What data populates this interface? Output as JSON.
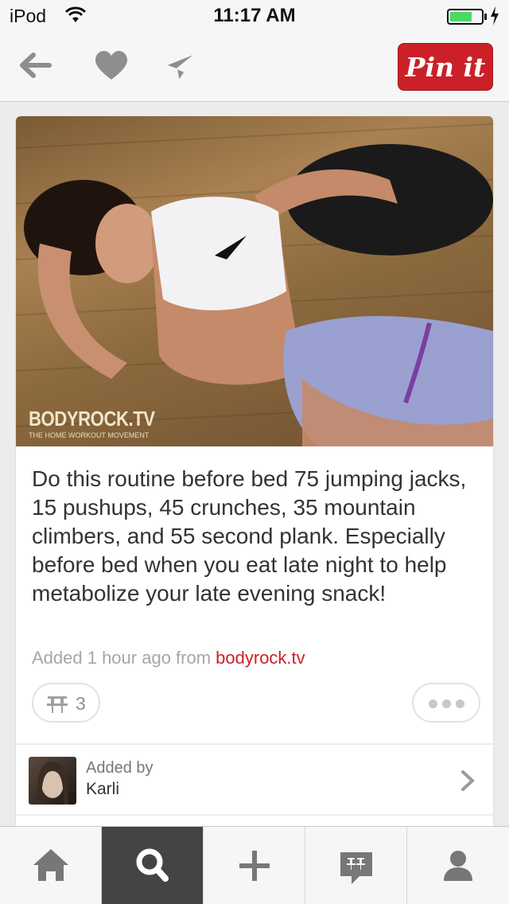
{
  "status_bar": {
    "carrier": "iPod",
    "time": "11:17 AM",
    "battery_level": 0.7,
    "battery_color": "#4cd964"
  },
  "nav_bar": {
    "back_icon": "back-arrow-icon",
    "like_icon": "heart-icon",
    "send_icon": "paper-plane-icon",
    "pin_it_label": "Pin it",
    "brand_color": "#cb2027"
  },
  "pin": {
    "image_watermark": "BODYROCK.TV",
    "image_watermark_sub": "THE HOME WORKOUT MOVEMENT",
    "description": "Do this routine before bed 75 jumping jacks, 15 pushups, 45 crunches, 35 mountain climbers, and 55 second plank. Especially before bed when you eat late night to help metabolize your late evening snack!",
    "added_prefix": "Added 1 hour ago from ",
    "source": "bodyrock.tv",
    "repin_count": "3",
    "added_by_label": "Added by",
    "added_by_name": "Karli"
  },
  "tab_bar": {
    "tabs": [
      {
        "icon": "home-icon",
        "active": false
      },
      {
        "icon": "search-icon",
        "active": true
      },
      {
        "icon": "plus-icon",
        "active": false
      },
      {
        "icon": "news-icon",
        "active": false
      },
      {
        "icon": "profile-icon",
        "active": false
      }
    ]
  }
}
